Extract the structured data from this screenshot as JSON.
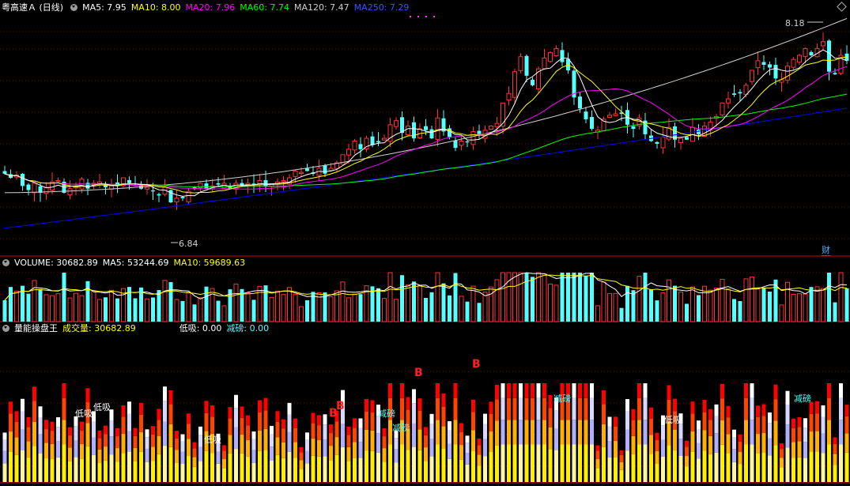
{
  "main_legend": {
    "stock": "粤高速Ａ (日线)",
    "ma5": "MA5: 7.95",
    "ma10": "MA10: 8.00",
    "ma20": "MA20: 7.96",
    "ma60": "MA60: 7.74",
    "ma120": "MA120: 7.47",
    "ma250": "MA250: 7.29"
  },
  "vol_legend": {
    "volume": "VOLUME: 30682.89",
    "ma5": "MA5: 53244.69",
    "ma10": "MA10: 59689.63"
  },
  "ind_legend": {
    "name": "量能操盘王",
    "cjl": "成交量: 30682.89",
    "dixi": "低吸: 0.00",
    "jianbang": "减磅: 0.00"
  },
  "annotations": {
    "high": "8.18",
    "low": "6.84",
    "cai": "财"
  },
  "colors": {
    "up": "#ff3333",
    "down": "#54ffff",
    "ma5": "#ffffff",
    "ma10": "#ffff00",
    "ma20": "#ff00ff",
    "ma60": "#00ff00",
    "ma120": "#d0d0d0",
    "ma250": "#0000ff",
    "grid": "#7a0000",
    "axis": "#b00000"
  },
  "chart_data": {
    "type": "candlestick",
    "title": "粤高速Ａ (日线)",
    "price_range_visible": [
      6.84,
      8.18
    ],
    "ma_latest": {
      "MA5": 7.95,
      "MA10": 8.0,
      "MA20": 7.96,
      "MA60": 7.74,
      "MA120": 7.47,
      "MA250": 7.29
    },
    "volume_latest": 30682.89,
    "volume_ma_latest": {
      "MA5": 53244.69,
      "MA10": 59689.63
    },
    "indicator_latest": {
      "成交量": 30682.89,
      "低吸": 0.0,
      "减磅": 0.0
    },
    "closes": [
      7.12,
      7.09,
      7.11,
      7.03,
      7.0,
      7.05,
      6.98,
      7.02,
      7.06,
      7.07,
      6.98,
      7.01,
      7.03,
      7.08,
      7.01,
      7.05,
      7.06,
      7.02,
      7.03,
      7.03,
      7.09,
      7.05,
      7.03,
      7.01,
      7.02,
      6.99,
      6.96,
      7.02,
      6.91,
      6.94,
      6.94,
      6.99,
      7.01,
      7.05,
      7.01,
      7.03,
      7.04,
      7.05,
      7.01,
      7.05,
      7.03,
      7.05,
      7.04,
      7.07,
      7.03,
      7.04,
      7.06,
      7.07,
      7.09,
      7.14,
      7.13,
      7.14,
      7.12,
      7.16,
      7.12,
      7.16,
      7.2,
      7.26,
      7.3,
      7.36,
      7.3,
      7.38,
      7.33,
      7.35,
      7.38,
      7.48,
      7.51,
      7.42,
      7.47,
      7.38,
      7.45,
      7.44,
      7.38,
      7.53,
      7.43,
      7.39,
      7.31,
      7.36,
      7.35,
      7.43,
      7.41,
      7.44,
      7.47,
      7.49,
      7.64,
      7.71,
      7.87,
      7.98,
      7.84,
      7.77,
      7.89,
      7.97,
      8.01,
      8.04,
      7.94,
      7.88,
      7.68,
      7.6,
      7.52,
      7.45,
      7.44,
      7.52,
      7.55,
      7.56,
      7.56,
      7.48,
      7.45,
      7.53,
      7.41,
      7.36,
      7.34,
      7.39,
      7.46,
      7.37,
      7.38,
      7.37,
      7.46,
      7.41,
      7.47,
      7.5,
      7.54,
      7.64,
      7.67,
      7.7,
      7.71,
      7.77,
      7.88,
      7.95,
      7.92,
      7.9,
      7.82,
      7.81,
      7.91,
      7.96,
      7.99,
      8.04,
      7.99,
      8.04,
      8.09,
      7.87,
      7.85,
      7.99,
      7.95
    ]
  }
}
